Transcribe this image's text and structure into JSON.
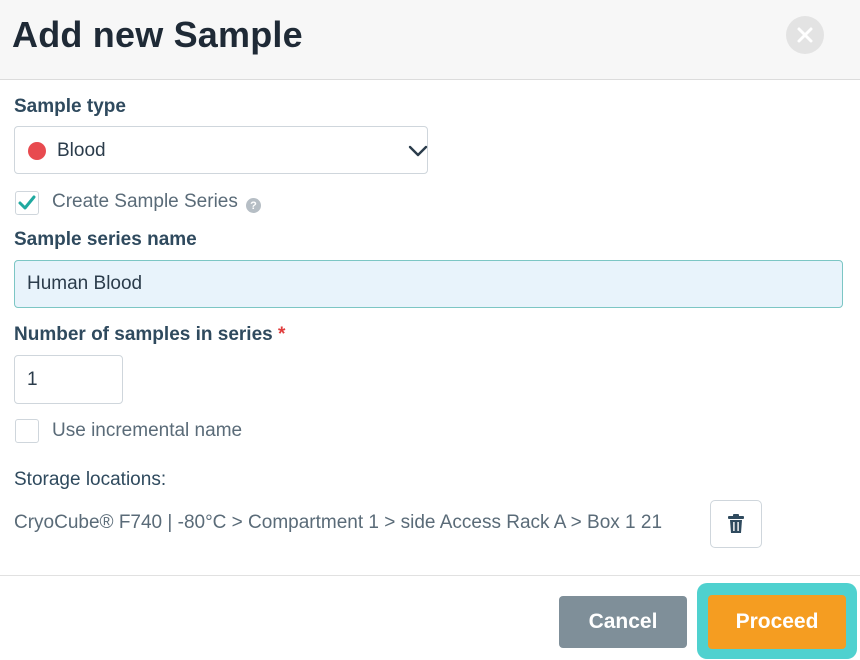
{
  "dialog": {
    "title": "Add new Sample"
  },
  "sample_type": {
    "label": "Sample type",
    "selected": "Blood",
    "dot_color": "#e84a4f"
  },
  "create_series": {
    "label": "Create Sample Series",
    "checked": true,
    "help": "?"
  },
  "series_name": {
    "label": "Sample series name",
    "value": "Human Blood"
  },
  "num_samples": {
    "label": "Number of samples in series",
    "required_mark": "*",
    "value": "1"
  },
  "incremental": {
    "label": "Use incremental name",
    "checked": false
  },
  "storage": {
    "label": "Storage locations:",
    "path": "CryoCube® F740 | -80°C > Compartment 1 > side Access Rack A > Box 1 21"
  },
  "footer": {
    "cancel_label": "Cancel",
    "proceed_label": "Proceed"
  },
  "colors": {
    "accent_teal": "#1fa9a0",
    "proceed_orange": "#f59d21",
    "cancel_gray": "#7f8f99",
    "focus_ring": "#4fd1cf"
  }
}
